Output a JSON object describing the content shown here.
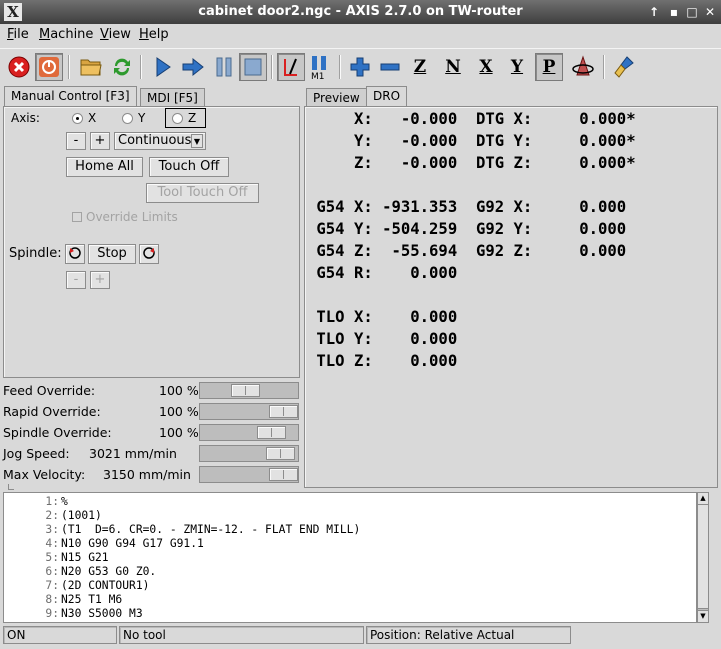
{
  "window": {
    "title": "cabinet door2.ngc - AXIS 2.7.0 on TW-router"
  },
  "menubar": {
    "items": [
      {
        "label": "File",
        "ul": "F",
        "rest": "ile"
      },
      {
        "label": "Machine",
        "ul": "M",
        "rest": "achine"
      },
      {
        "label": "View",
        "ul": "V",
        "rest": "iew"
      },
      {
        "label": "Help",
        "ul": "H",
        "rest": "elp"
      }
    ]
  },
  "toolbar": {
    "axis_buttons": [
      "Z",
      "N",
      "X",
      "Y",
      "P"
    ],
    "m1_label": "M1"
  },
  "left_tabs": {
    "manual": "Manual Control [F3]",
    "mdi": "MDI [F5]"
  },
  "manual": {
    "axis_label": "Axis:",
    "axes": [
      "X",
      "Y",
      "Z"
    ],
    "selected_axis": "Z",
    "jog_minus": "-",
    "jog_plus": "+",
    "increment": "Continuous",
    "home_all": "Home All",
    "touch_off": "Touch Off",
    "tool_touch_off": "Tool Touch Off",
    "override_limits": "Override Limits",
    "spindle_label": "Spindle:",
    "spindle_stop": "Stop",
    "spindle_minus": "-",
    "spindle_plus": "+"
  },
  "right_tabs": {
    "preview": "Preview",
    "dro": "DRO"
  },
  "dro": {
    "lines": [
      "     X:   -0.000  DTG X:     0.000*",
      "     Y:   -0.000  DTG Y:     0.000*",
      "     Z:   -0.000  DTG Z:     0.000*",
      "",
      " G54 X: -931.353  G92 X:     0.000",
      " G54 Y: -504.259  G92 Y:     0.000",
      " G54 Z:  -55.694  G92 Z:     0.000",
      " G54 R:    0.000",
      "",
      " TLO X:    0.000",
      " TLO Y:    0.000",
      " TLO Z:    0.000"
    ]
  },
  "sliders": [
    {
      "name": "Feed Override:",
      "value": "100 %",
      "fraction": 0.45
    },
    {
      "name": "Rapid Override:",
      "value": "100 %",
      "fraction": 1.0
    },
    {
      "name": "Spindle Override:",
      "value": "100 %",
      "fraction": 0.83
    },
    {
      "name": "Jog Speed:",
      "value": "3021 mm/min",
      "fraction": 0.96
    },
    {
      "name": "Max Velocity:",
      "value": "3150 mm/min",
      "fraction": 1.0
    }
  ],
  "gcode": [
    {
      "n": "1:",
      "t": "%"
    },
    {
      "n": "2:",
      "t": "(1001)"
    },
    {
      "n": "3:",
      "t": "(T1  D=6. CR=0. - ZMIN=-12. - FLAT END MILL)"
    },
    {
      "n": "4:",
      "t": "N10 G90 G94 G17 G91.1"
    },
    {
      "n": "5:",
      "t": "N15 G21"
    },
    {
      "n": "6:",
      "t": "N20 G53 G0 Z0."
    },
    {
      "n": "7:",
      "t": "(2D CONTOUR1)"
    },
    {
      "n": "8:",
      "t": "N25 T1 M6"
    },
    {
      "n": "9:",
      "t": "N30 S5000 M3"
    }
  ],
  "statusbar": {
    "state": "ON",
    "tool": "No tool",
    "position": "Position: Relative Actual"
  },
  "colors": {
    "titlebar": "#4a4a4a",
    "stop_red": "#d92020",
    "run_blue": "#2f72c4",
    "refresh_green": "#2e9a2e",
    "estop_orange": "#e06a3b"
  }
}
